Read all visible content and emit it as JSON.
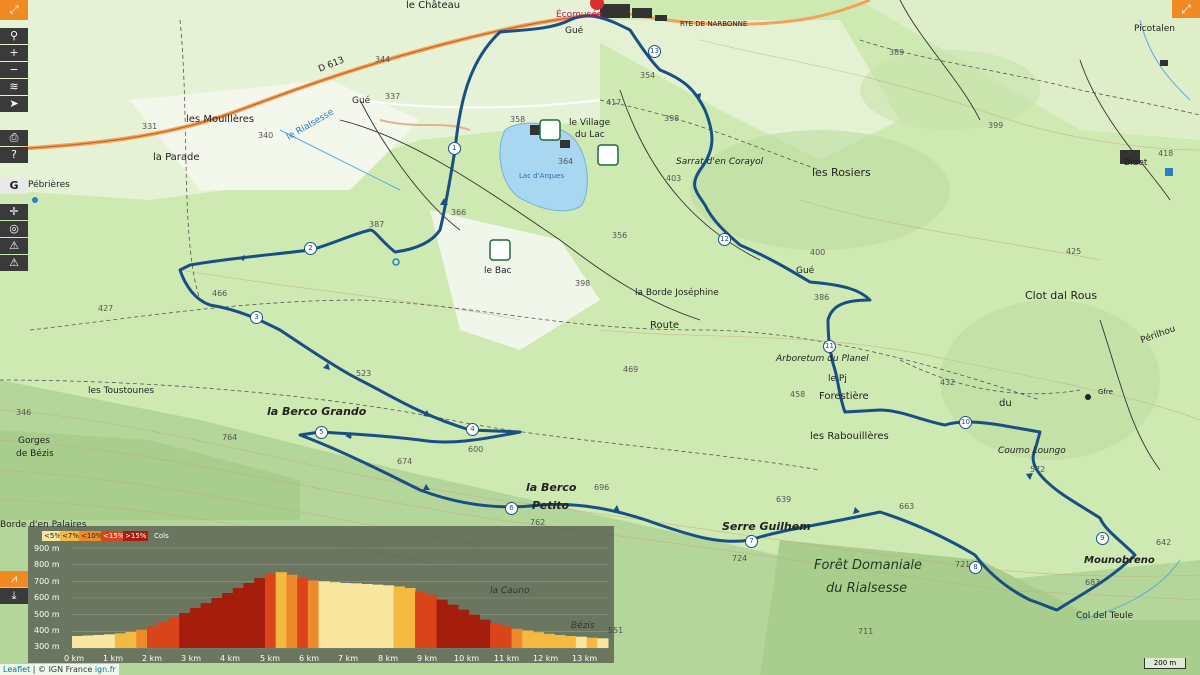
{
  "toolbar": {
    "fullscreen_icon": "expand-icon",
    "tools": [
      "search-icon",
      "zoom-in-icon",
      "zoom-out-icon",
      "layers-icon",
      "locate-icon",
      "print-icon",
      "help-icon",
      "google-icon",
      "compass-icon",
      "globe-icon",
      "hiker-icon",
      "warning-icon"
    ],
    "g_label": "G"
  },
  "places": {
    "le_chateau": "le Château",
    "ecomusee": "Écomusée",
    "les_mouilleres": "les Mouillères",
    "la_parade": "la Parade",
    "pebrieres": "Pébrières",
    "le_village_du_lac_1": "le Village",
    "le_village_du_lac_2": "du Lac",
    "lac_darques": "Lac d'Arques",
    "le_bac": "le Bac",
    "sarrat": "Sarrat d'en Corayol",
    "les_rosiers": "les Rosiers",
    "bidet": "Bidet",
    "picotalen": "Picotalen",
    "la_borde": "la Borde Joséphine",
    "route": "Route",
    "gue1": "Gué",
    "gue2": "Gué",
    "gue3": "Gué",
    "arboretum": "Arboretum du Planel",
    "forestiere": "Forestière",
    "du": "du",
    "clot_dal_rous": "Clot dal Rous",
    "perilhou": "Périlhou",
    "gfre": "Gfre",
    "les_toustounes": "les Toustounes",
    "gorges": "Gorges",
    "de_bezis": "de Bézis",
    "la_berco_grando": "la Berco Grando",
    "les_rabouilleres": "les Rabouillères",
    "coumo_loungo": "Coumo Loungo",
    "la_berco_petito_1": "la Berco",
    "la_berco_petito_2": "Petito",
    "serre_guilhem": "Serre Guilhem",
    "foret_1": "Forêt Domaniale",
    "foret_2": "du Rialsesse",
    "mounobreno": "Mounobreno",
    "col_del_teule": "Col del Teule",
    "la_cauno": "la Cauno",
    "bezis": "Bézis",
    "borde_en_palaires": "Borde d'en Palaires",
    "route_narbonne": "RTE DE NARBONNE",
    "d613": "D 613",
    "rialsesse": "le Rialsesse",
    "le_pj": "le Pj"
  },
  "altitudes": [
    "344",
    "337",
    "331",
    "340",
    "417",
    "358",
    "354",
    "398",
    "389",
    "399",
    "418",
    "403",
    "364",
    "356",
    "366",
    "387",
    "398",
    "386",
    "400",
    "425",
    "466",
    "427",
    "523",
    "469",
    "458",
    "432",
    "764",
    "674",
    "696",
    "639",
    "663",
    "642",
    "724",
    "721",
    "683",
    "711",
    "762",
    "346",
    "600",
    "572",
    "551"
  ],
  "waypoints": [
    "1",
    "2",
    "3",
    "4",
    "5",
    "6",
    "7",
    "8",
    "9",
    "10",
    "11",
    "12",
    "13"
  ],
  "profile": {
    "legend": [
      "<5%",
      "<7%",
      "<10%",
      "<15%",
      ">15%"
    ],
    "legend_colors": [
      "#f9e79f",
      "#f4b942",
      "#ef8a2c",
      "#d9441b",
      "#a51d0d"
    ],
    "cols_label": "Cols",
    "y_labels": [
      "900 m",
      "800 m",
      "700 m",
      "600 m",
      "500 m",
      "400 m",
      "300 m"
    ],
    "y_range": [
      300,
      900
    ],
    "x_labels": [
      "0 km",
      "1 km",
      "2 km",
      "3 km",
      "4 km",
      "5 km",
      "6 km",
      "7 km",
      "8 km",
      "9 km",
      "10 km",
      "11 km",
      "12 km",
      "13 km"
    ],
    "chart_icon": "chart-icon",
    "download_icon": "download-icon",
    "elevations": [
      372,
      375,
      378,
      382,
      388,
      396,
      410,
      430,
      455,
      480,
      510,
      540,
      570,
      600,
      630,
      660,
      690,
      720,
      745,
      755,
      740,
      720,
      705,
      700,
      695,
      690,
      688,
      684,
      680,
      676,
      670,
      660,
      640,
      620,
      590,
      560,
      530,
      500,
      470,
      450,
      430,
      415,
      405,
      395,
      385,
      378,
      372,
      368,
      362,
      358
    ]
  },
  "attribution": {
    "leaflet": "Leaflet",
    "rest": " | © IGN France ",
    "ign": "ign.fr"
  },
  "scale": "200 m"
}
